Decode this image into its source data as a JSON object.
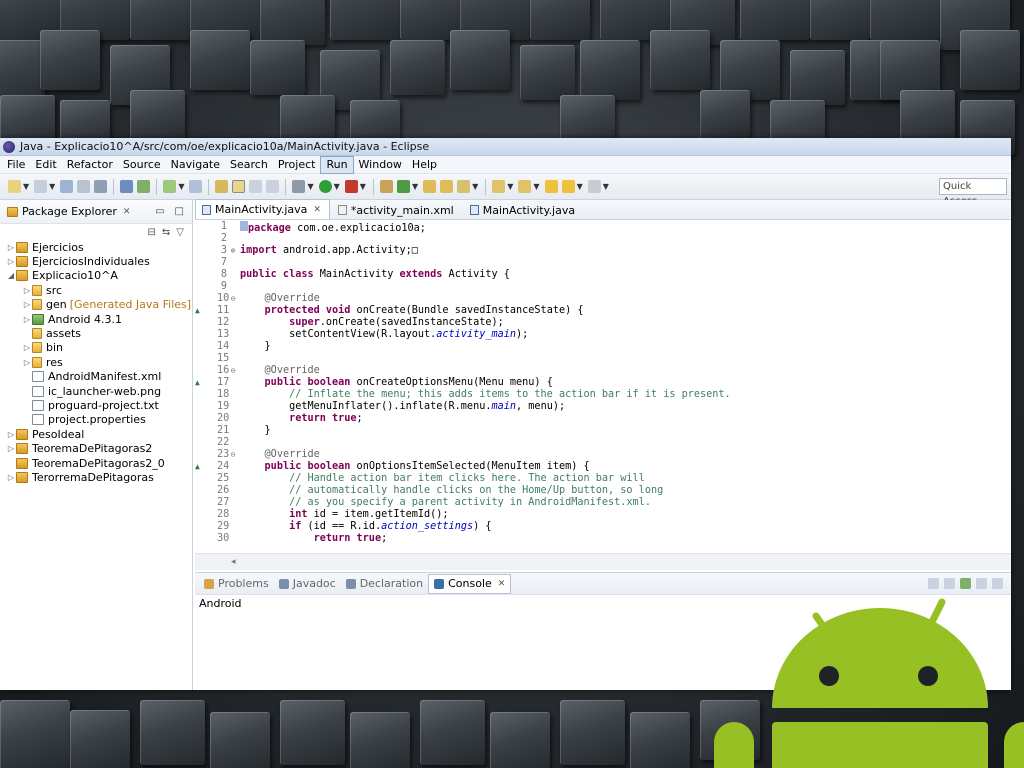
{
  "window": {
    "title": "Java - Explicacio10^A/src/com/oe/explicacio10a/MainActivity.java - Eclipse"
  },
  "menubar": {
    "items": [
      "File",
      "Edit",
      "Refactor",
      "Source",
      "Navigate",
      "Search",
      "Project",
      "Run",
      "Window",
      "Help"
    ],
    "active": "Run"
  },
  "toolbar": {
    "quick_access": "Quick Access"
  },
  "package_explorer": {
    "title": "Package Explorer",
    "items": [
      {
        "label": "Ejercicios",
        "level": 0,
        "icon": "project-icon",
        "expanded": false
      },
      {
        "label": "EjerciciosIndividuales",
        "level": 0,
        "icon": "project-icon",
        "expanded": false
      },
      {
        "label": "Explicacio10^A",
        "level": 0,
        "icon": "project-icon",
        "expanded": true
      },
      {
        "label": "src",
        "level": 1,
        "icon": "folder-icon",
        "expanded": false
      },
      {
        "label": "gen",
        "extra": "[Generated Java Files]",
        "level": 1,
        "icon": "folder-icon",
        "expanded": false
      },
      {
        "label": "Android 4.3.1",
        "level": 1,
        "icon": "library-icon",
        "expanded": false
      },
      {
        "label": "assets",
        "level": 1,
        "icon": "folder-icon",
        "leaf": true
      },
      {
        "label": "bin",
        "level": 1,
        "icon": "folder-icon",
        "expanded": false
      },
      {
        "label": "res",
        "level": 1,
        "icon": "folder-icon",
        "expanded": false
      },
      {
        "label": "AndroidManifest.xml",
        "level": 1,
        "icon": "file-icon",
        "leaf": true
      },
      {
        "label": "ic_launcher-web.png",
        "level": 1,
        "icon": "file-icon",
        "leaf": true
      },
      {
        "label": "proguard-project.txt",
        "level": 1,
        "icon": "file-icon",
        "leaf": true
      },
      {
        "label": "project.properties",
        "level": 1,
        "icon": "file-icon",
        "leaf": true
      },
      {
        "label": "PesoIdeal",
        "level": 0,
        "icon": "project-icon",
        "expanded": false
      },
      {
        "label": "TeoremaDePitagoras2",
        "level": 0,
        "icon": "project-icon",
        "expanded": false
      },
      {
        "label": "TeoremaDePitagoras2_0",
        "level": 0,
        "icon": "project-icon",
        "leaf": true
      },
      {
        "label": "TerorremaDePitagoras",
        "level": 0,
        "icon": "project-icon",
        "expanded": false
      }
    ]
  },
  "editor": {
    "tabs": [
      {
        "label": "MainActivity.java",
        "active": true,
        "icon": "java-file-icon"
      },
      {
        "label": "*activity_main.xml",
        "active": false,
        "icon": "xml-file-icon"
      },
      {
        "label": "MainActivity.java",
        "active": false,
        "icon": "java-file-icon"
      }
    ],
    "lines": [
      {
        "n": "1",
        "html": "<span class=\"blueblk\"></span><span class=\"kw\">package</span> com.oe.explicacio10a;"
      },
      {
        "n": "2",
        "html": ""
      },
      {
        "n": "3",
        "fold": "⊕",
        "html": "<span class=\"kw\">import</span> android.app.Activity;&#9633;"
      },
      {
        "n": "7",
        "html": ""
      },
      {
        "n": "8",
        "html": "<span class=\"kw\">public class</span> MainActivity <span class=\"kw\">extends</span> Activity {"
      },
      {
        "n": "9",
        "html": ""
      },
      {
        "n": "10",
        "fold": "⊖",
        "html": "    <span class=\"an\">@Override</span>"
      },
      {
        "n": "11",
        "mark": true,
        "html": "    <span class=\"kw\">protected void</span> onCreate(Bundle savedInstanceState) {"
      },
      {
        "n": "12",
        "html": "        <span class=\"kw\">super</span>.onCreate(savedInstanceState);"
      },
      {
        "n": "13",
        "html": "        setContentView(R.layout.<span class=\"it\">activity_main</span>);"
      },
      {
        "n": "14",
        "html": "    }"
      },
      {
        "n": "15",
        "html": ""
      },
      {
        "n": "16",
        "fold": "⊖",
        "html": "    <span class=\"an\">@Override</span>"
      },
      {
        "n": "17",
        "mark": true,
        "html": "    <span class=\"kw\">public boolean</span> onCreateOptionsMenu(Menu menu) {"
      },
      {
        "n": "18",
        "html": "        <span class=\"cm\">// Inflate the menu; this adds items to the action bar if it is present.</span>"
      },
      {
        "n": "19",
        "html": "        getMenuInflater().inflate(R.menu.<span class=\"it\">main</span>, menu);"
      },
      {
        "n": "20",
        "html": "        <span class=\"kw\">return true</span>;"
      },
      {
        "n": "21",
        "html": "    }"
      },
      {
        "n": "22",
        "html": ""
      },
      {
        "n": "23",
        "fold": "⊖",
        "html": "    <span class=\"an\">@Override</span>"
      },
      {
        "n": "24",
        "mark": true,
        "html": "    <span class=\"kw\">public boolean</span> onOptionsItemSelected(MenuItem item) {"
      },
      {
        "n": "25",
        "html": "        <span class=\"cm\">// Handle action bar item clicks here. The action bar will</span>"
      },
      {
        "n": "26",
        "html": "        <span class=\"cm\">// automatically handle clicks on the Home/Up button, so long</span>"
      },
      {
        "n": "27",
        "html": "        <span class=\"cm\">// as you specify a parent activity in AndroidManifest.xml.</span>"
      },
      {
        "n": "28",
        "html": "        <span class=\"kw\">int</span> id = item.getItemId();"
      },
      {
        "n": "29",
        "html": "        <span class=\"kw\">if</span> (id == R.id.<span class=\"it\">action_settings</span>) {"
      },
      {
        "n": "30",
        "html": "            <span class=\"kw\">return true</span>;"
      }
    ]
  },
  "bottom_panel": {
    "tabs": [
      {
        "label": "Problems",
        "active": false
      },
      {
        "label": "Javadoc",
        "active": false
      },
      {
        "label": "Declaration",
        "active": false
      },
      {
        "label": "Console",
        "active": true
      }
    ],
    "console_label": "Android"
  },
  "colors": {
    "android_green": "#97c024"
  }
}
